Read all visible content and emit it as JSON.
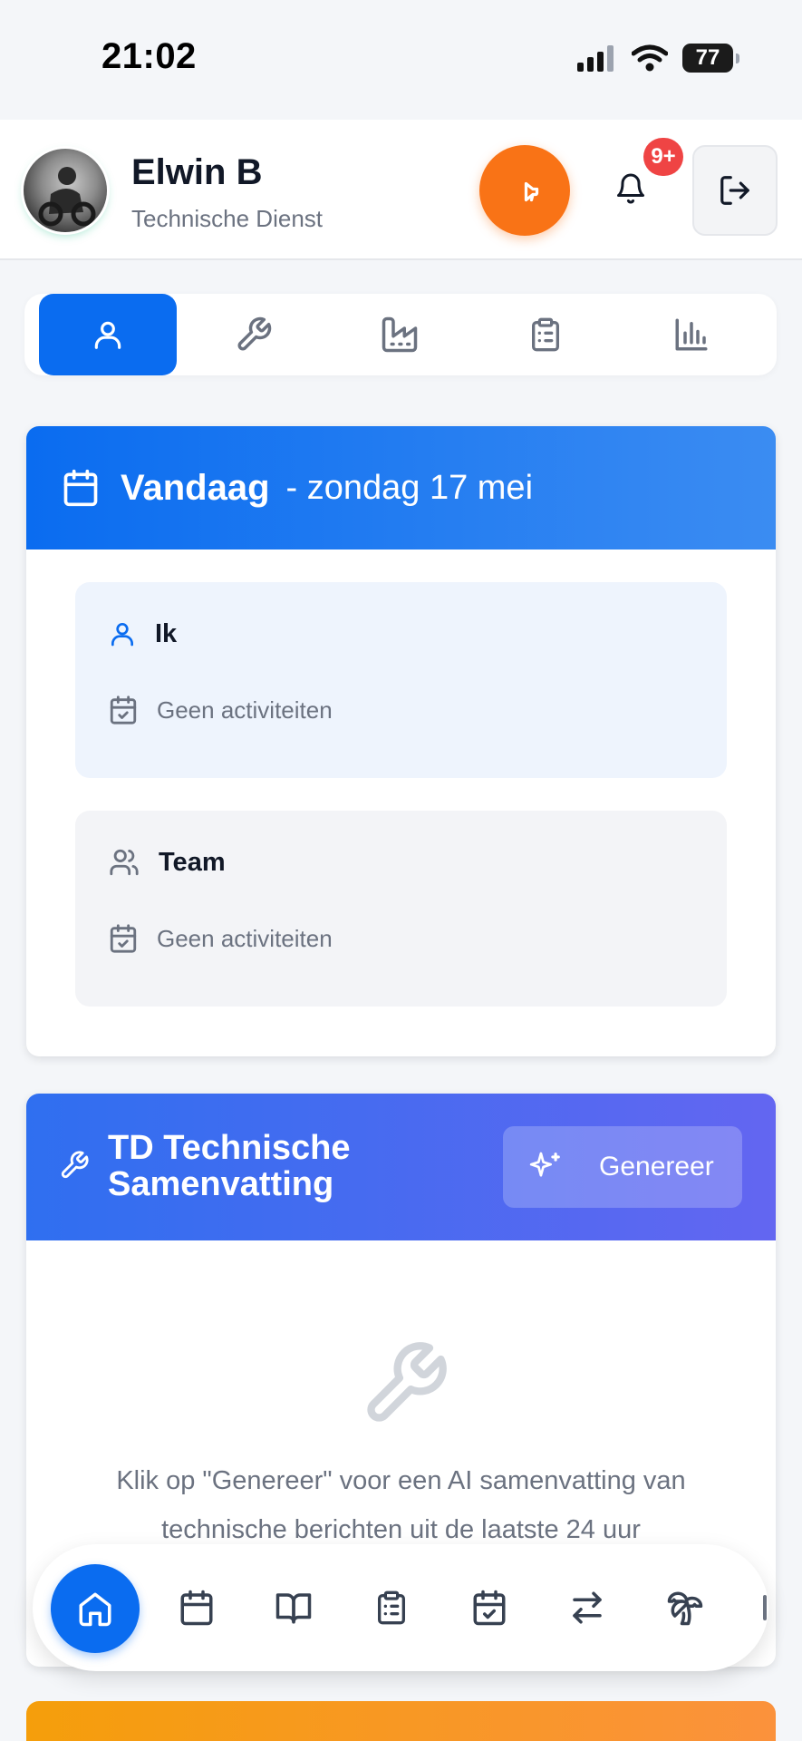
{
  "status_bar": {
    "time": "21:02",
    "battery": "77",
    "icons": [
      "signal-icon",
      "wifi-icon",
      "battery-icon"
    ]
  },
  "header": {
    "user_name": "Elwin B",
    "user_role": "Technische Dienst",
    "notification_badge": "9+",
    "icons": [
      "megaphone-icon",
      "bell-icon",
      "logout-icon"
    ],
    "accent": "#f97316"
  },
  "tabs": [
    {
      "icon": "user-icon",
      "active": true
    },
    {
      "icon": "wrench-icon",
      "active": false
    },
    {
      "icon": "factory-icon",
      "active": false
    },
    {
      "icon": "clipboard-list-icon",
      "active": false
    },
    {
      "icon": "bar-chart-icon",
      "active": false
    }
  ],
  "today": {
    "title": "Vandaag",
    "date": "- zondag 17 mei",
    "sections": [
      {
        "title": "Ik",
        "empty_text": "Geen activiteiten",
        "icon": "user-icon"
      },
      {
        "title": "Team",
        "empty_text": "Geen activiteiten",
        "icon": "users-icon"
      }
    ]
  },
  "td_summary": {
    "title": "TD Technische Samenvatting",
    "generate_label": "Genereer",
    "message": "Klik op \"Genereer\" voor een AI samenvatting van technische berichten uit de laatste 24 uur"
  },
  "bottom_nav": [
    {
      "icon": "home-icon",
      "active": true
    },
    {
      "icon": "calendar-icon",
      "active": false
    },
    {
      "icon": "book-open-icon",
      "active": false
    },
    {
      "icon": "clipboard-list-icon",
      "active": false
    },
    {
      "icon": "calendar-check-icon",
      "active": false
    },
    {
      "icon": "arrows-swap-icon",
      "active": false
    },
    {
      "icon": "palm-tree-icon",
      "active": false
    }
  ],
  "colors": {
    "primary": "#0a6cf0",
    "orange": "#f97316",
    "indigo": "#6366f1",
    "badge": "#ef4444"
  }
}
